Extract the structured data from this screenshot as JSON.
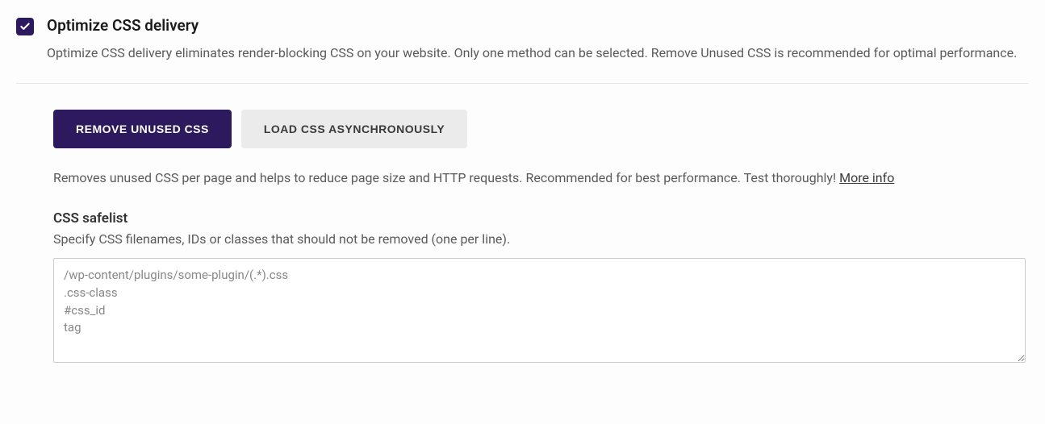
{
  "option": {
    "title": "Optimize CSS delivery",
    "description": "Optimize CSS delivery eliminates render-blocking CSS on your website. Only one method can be selected. Remove Unused CSS is recommended for optimal performance.",
    "checked": true
  },
  "tabs": {
    "remove_unused": "REMOVE UNUSED CSS",
    "load_async": "LOAD CSS ASYNCHRONOUSLY"
  },
  "tab_description": "Removes unused CSS per page and helps to reduce page size and HTTP requests. Recommended for best performance. Test thoroughly! ",
  "more_info": "More info",
  "safelist": {
    "label": "CSS safelist",
    "help": "Specify CSS filenames, IDs or classes that should not be removed (one per line).",
    "placeholder": "/wp-content/plugins/some-plugin/(.*).css\n.css-class\n#css_id\ntag",
    "value": ""
  }
}
